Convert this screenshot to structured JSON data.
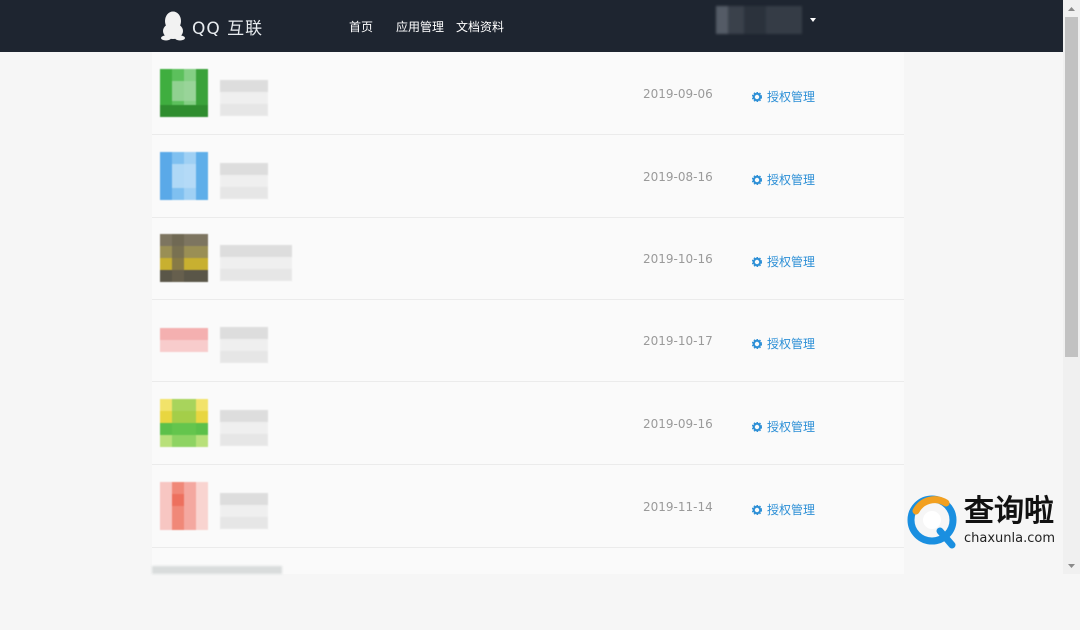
{
  "header": {
    "logo_text": "QQ 互联",
    "nav": [
      {
        "label": "首页"
      },
      {
        "label": "应用管理"
      },
      {
        "label": "文档资料"
      }
    ]
  },
  "apps": [
    {
      "date": "2019-09-06",
      "action": "授权管理"
    },
    {
      "date": "2019-08-16",
      "action": "授权管理"
    },
    {
      "date": "2019-10-16",
      "action": "授权管理"
    },
    {
      "date": "2019-10-17",
      "action": "授权管理"
    },
    {
      "date": "2019-09-16",
      "action": "授权管理"
    },
    {
      "date": "2019-11-14",
      "action": "授权管理"
    }
  ],
  "watermark": {
    "brand": "查询啦",
    "url": "chaxunla.com"
  },
  "colors": {
    "topbar": "#1e2530",
    "link": "#2c8fd6",
    "date": "#9a9a9a"
  }
}
